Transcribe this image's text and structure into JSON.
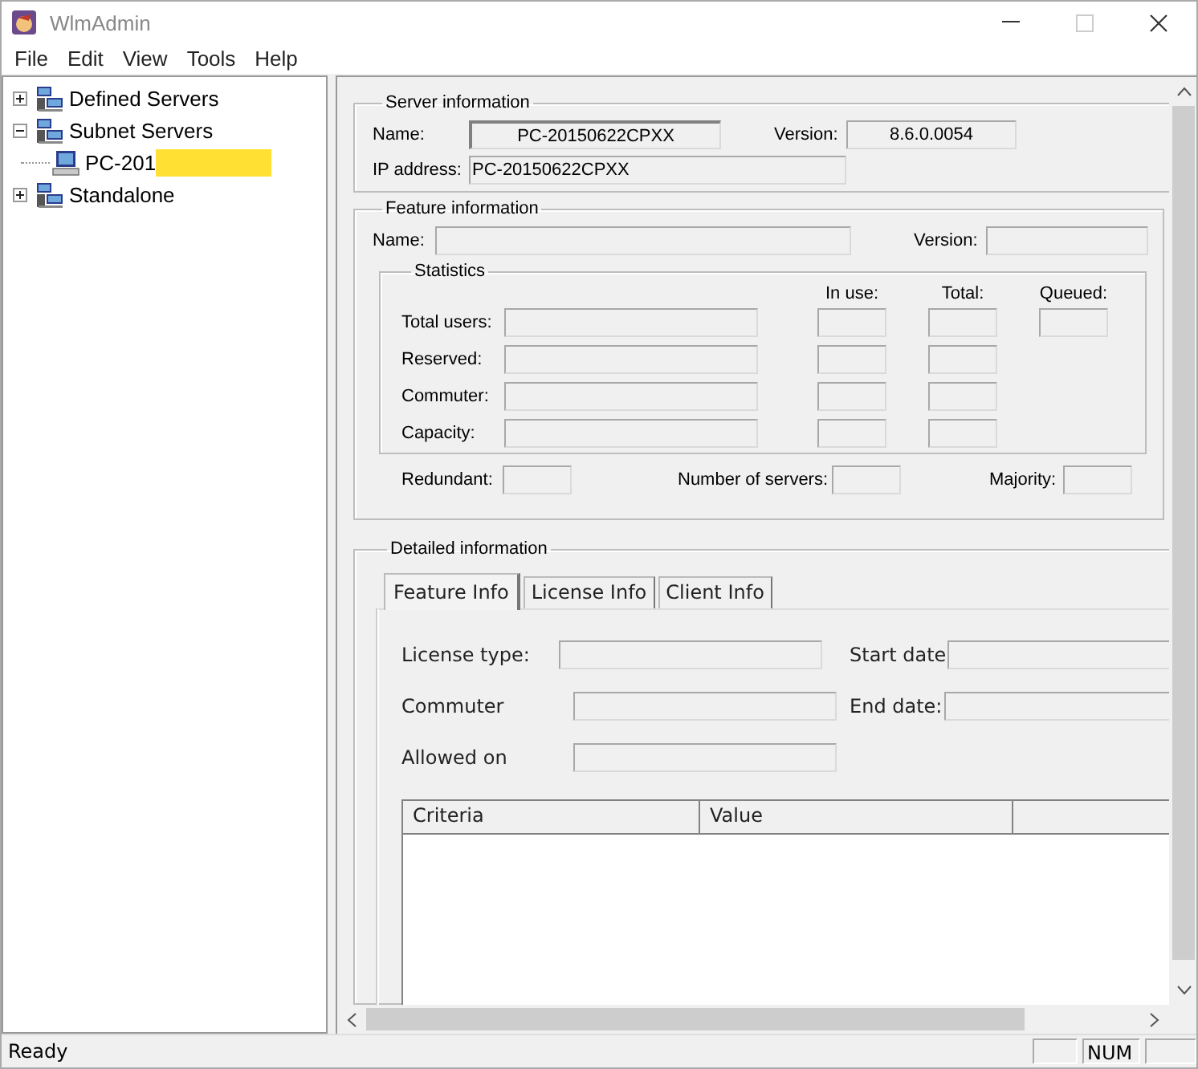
{
  "window": {
    "title": "WlmAdmin"
  },
  "menu": [
    "File",
    "Edit",
    "View",
    "Tools",
    "Help"
  ],
  "tree": [
    {
      "label": "Defined Servers",
      "expanded": false
    },
    {
      "label": "Subnet Servers",
      "expanded": true,
      "children": [
        {
          "label": "PC-201",
          "redacted": true
        }
      ]
    },
    {
      "label": "Standalone",
      "expanded": false
    }
  ],
  "server_info": {
    "title": "Server information",
    "name_label": "Name:",
    "name": "PC-20150622CPXX",
    "version_label": "Version:",
    "version": "8.6.0.0054",
    "ip_label": "IP address:",
    "ip": "PC-20150622CPXX"
  },
  "feature_info": {
    "title": "Feature information",
    "name_label": "Name:",
    "version_label": "Version:",
    "statistics": {
      "title": "Statistics",
      "columns": [
        "In use:",
        "Total:",
        "Queued:"
      ],
      "rows": [
        {
          "label": "Total users:",
          "queued_field": true
        },
        {
          "label": "Reserved:",
          "queued_field": false
        },
        {
          "label": "Commuter:",
          "queued_field": false
        },
        {
          "label": "Capacity:",
          "queued_field": false
        }
      ]
    },
    "summary": [
      {
        "label": "Redundant:"
      },
      {
        "label": "Number of servers:"
      },
      {
        "label": "Majority:"
      }
    ]
  },
  "detailed_info": {
    "title": "Detailed information",
    "tabs": [
      {
        "label": "Feature Info",
        "selected": true
      },
      {
        "label": "License Info",
        "selected": false
      },
      {
        "label": "Client Info",
        "selected": false
      }
    ],
    "rows": [
      {
        "label": "License type:",
        "right_label": "Start date"
      },
      {
        "label": "Commuter",
        "right_label": "End date:"
      },
      {
        "label": "Allowed on"
      }
    ],
    "table": {
      "columns": [
        "Criteria",
        "Value"
      ]
    }
  },
  "status_bar": {
    "text": "Ready",
    "indicators": [
      "NUM"
    ]
  }
}
